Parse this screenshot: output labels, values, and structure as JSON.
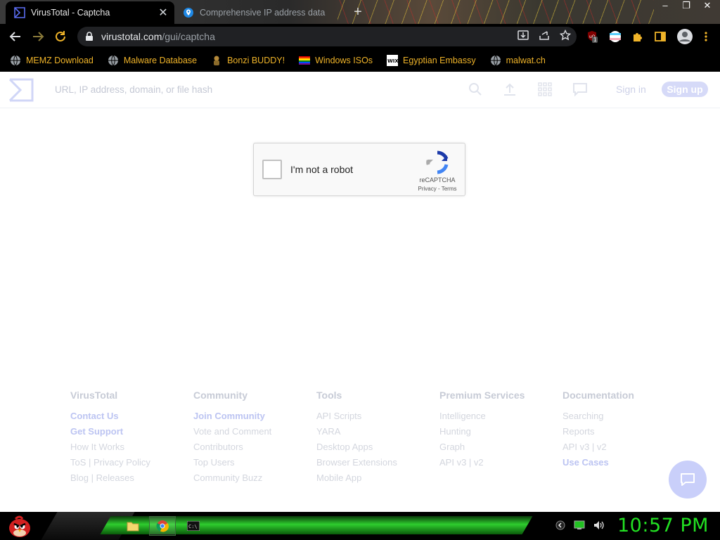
{
  "browser": {
    "tabs": [
      {
        "title": "VirusTotal - Captcha",
        "active": true,
        "icon": "virustotal-icon"
      },
      {
        "title": "Comprehensive IP address data",
        "active": false,
        "icon": "location-pin-icon"
      }
    ],
    "url": {
      "host": "virustotal.com",
      "path": "/gui/captcha"
    },
    "bookmarks": [
      {
        "label": "MEMZ Download",
        "icon": "globe-icon"
      },
      {
        "label": "Malware Database",
        "icon": "globe-icon"
      },
      {
        "label": "Bonzi BUDDY!",
        "icon": "bonzi-icon"
      },
      {
        "label": "Windows ISOs",
        "icon": "rainbow-flag-icon"
      },
      {
        "label": "Egyptian Embassy",
        "icon": "wix-icon"
      },
      {
        "label": "malwat.ch",
        "icon": "globe-icon"
      }
    ],
    "extension_badge": "1",
    "accent": "#f0b429"
  },
  "vt": {
    "search_placeholder": "URL, IP address, domain, or file hash",
    "sign_in": "Sign in",
    "sign_up": "Sign up"
  },
  "captcha": {
    "label": "I'm not a robot",
    "brand": "reCAPTCHA",
    "privacy": "Privacy",
    "separator": " - ",
    "terms": "Terms"
  },
  "footer": {
    "columns": [
      {
        "heading": "VirusTotal",
        "links": [
          {
            "text": "Contact Us",
            "emphasis": true
          },
          {
            "text": "Get Support",
            "emphasis": true
          },
          {
            "text": "How It Works",
            "emphasis": false
          },
          {
            "text": "ToS | Privacy Policy",
            "emphasis": false
          },
          {
            "text": "Blog | Releases",
            "emphasis": false
          }
        ]
      },
      {
        "heading": "Community",
        "links": [
          {
            "text": "Join Community",
            "emphasis": true
          },
          {
            "text": "Vote and Comment",
            "emphasis": false
          },
          {
            "text": "Contributors",
            "emphasis": false
          },
          {
            "text": "Top Users",
            "emphasis": false
          },
          {
            "text": "Community Buzz",
            "emphasis": false
          }
        ]
      },
      {
        "heading": "Tools",
        "links": [
          {
            "text": "API Scripts",
            "emphasis": false
          },
          {
            "text": "YARA",
            "emphasis": false
          },
          {
            "text": "Desktop Apps",
            "emphasis": false
          },
          {
            "text": "Browser Extensions",
            "emphasis": false
          },
          {
            "text": "Mobile App",
            "emphasis": false
          }
        ]
      },
      {
        "heading": "Premium Services",
        "links": [
          {
            "text": "Intelligence",
            "emphasis": false
          },
          {
            "text": "Hunting",
            "emphasis": false
          },
          {
            "text": "Graph",
            "emphasis": false
          },
          {
            "text": "API v3 | v2",
            "emphasis": false
          }
        ]
      },
      {
        "heading": "Documentation",
        "links": [
          {
            "text": "Searching",
            "emphasis": false
          },
          {
            "text": "Reports",
            "emphasis": false
          },
          {
            "text": "API v3 | v2",
            "emphasis": false
          },
          {
            "text": "Use Cases",
            "emphasis": true
          }
        ]
      }
    ]
  },
  "taskbar": {
    "clock": "10:57 PM",
    "clock_color": "#22e022"
  }
}
